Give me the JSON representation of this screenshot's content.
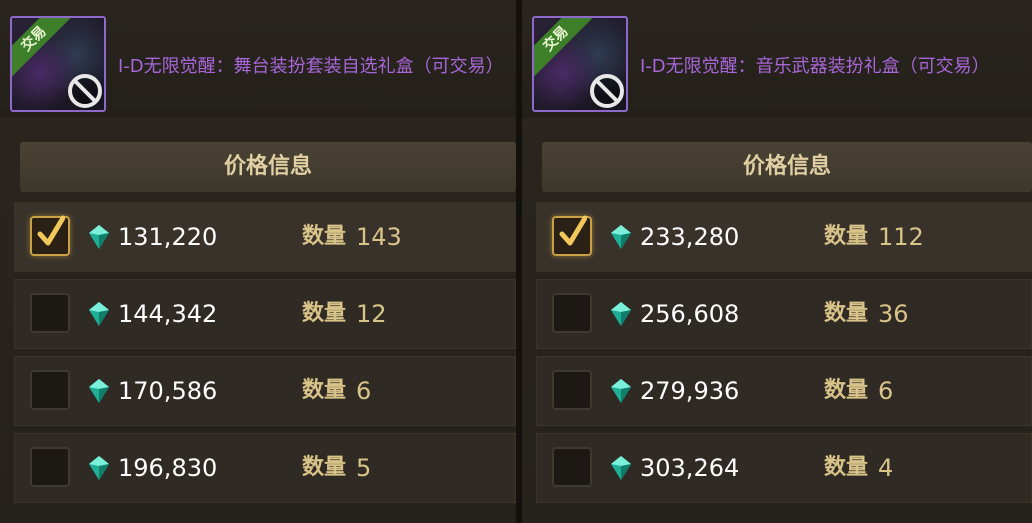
{
  "panels": [
    {
      "item": {
        "badge": "交易",
        "title": "I-D无限觉醒：舞台装扮套装自选礼盒（可交易）"
      },
      "price_header": "价格信息",
      "qty_label": "数量",
      "rows": [
        {
          "price": "131,220",
          "quantity": "143",
          "selected": true
        },
        {
          "price": "144,342",
          "quantity": "12",
          "selected": false
        },
        {
          "price": "170,586",
          "quantity": "6",
          "selected": false
        },
        {
          "price": "196,830",
          "quantity": "5",
          "selected": false
        }
      ]
    },
    {
      "item": {
        "badge": "交易",
        "title": "I-D无限觉醒：音乐武器装扮礼盒（可交易）"
      },
      "price_header": "价格信息",
      "qty_label": "数量",
      "rows": [
        {
          "price": "233,280",
          "quantity": "112",
          "selected": true
        },
        {
          "price": "256,608",
          "quantity": "36",
          "selected": false
        },
        {
          "price": "279,936",
          "quantity": "6",
          "selected": false
        },
        {
          "price": "303,264",
          "quantity": "4",
          "selected": false
        }
      ]
    }
  ],
  "colors": {
    "title_purple": "#a866d8",
    "gold_text": "#d9c389",
    "gem_teal": "#2fd1b2",
    "checkbox_gold": "#caa047"
  },
  "icons": {
    "currency": "gem-icon",
    "check": "checkmark-icon",
    "untradeable": "no-entry-icon"
  }
}
